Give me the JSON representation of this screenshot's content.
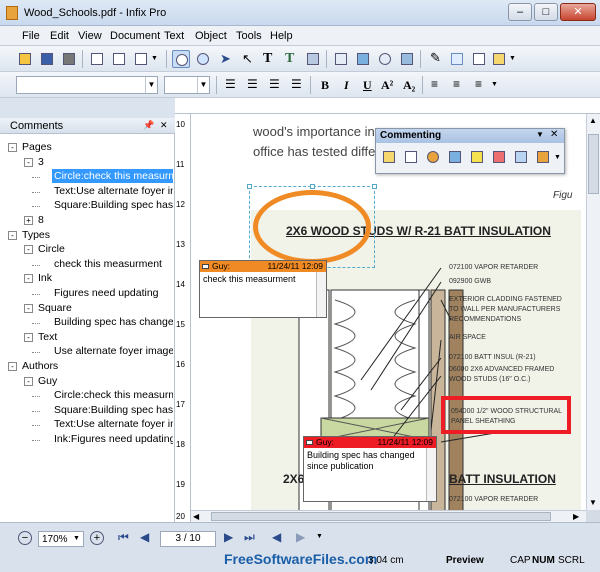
{
  "window": {
    "title": "Wood_Schools.pdf - Infix Pro",
    "min": "–",
    "max": "□",
    "close": "✕"
  },
  "menu": [
    "File",
    "Edit",
    "View",
    "Document",
    "Text",
    "Object",
    "Tools",
    "Help"
  ],
  "comments_panel": {
    "title": "Comments",
    "pin": "📌",
    "close": "✕",
    "tree": [
      {
        "label": "Pages",
        "level": 0,
        "exp": "-"
      },
      {
        "label": "3",
        "level": 1,
        "exp": "-"
      },
      {
        "label": "Circle:check this measurment",
        "level": 2,
        "selected": true
      },
      {
        "label": "Text:Use alternate foyer image",
        "level": 2
      },
      {
        "label": "Square:Building spec has changed",
        "level": 2
      },
      {
        "label": "8",
        "level": 1,
        "exp": "+"
      },
      {
        "label": "Types",
        "level": 0,
        "exp": "-"
      },
      {
        "label": "Circle",
        "level": 1,
        "exp": "-"
      },
      {
        "label": "check this measurment",
        "level": 2
      },
      {
        "label": "Ink",
        "level": 1,
        "exp": "-"
      },
      {
        "label": "Figures need updating",
        "level": 2
      },
      {
        "label": "Square",
        "level": 1,
        "exp": "-"
      },
      {
        "label": "Building spec has changed",
        "level": 2
      },
      {
        "label": "Text",
        "level": 1,
        "exp": "-"
      },
      {
        "label": "Use alternate foyer image",
        "level": 2
      },
      {
        "label": "Authors",
        "level": 0,
        "exp": "-"
      },
      {
        "label": "Guy",
        "level": 1,
        "exp": "-"
      },
      {
        "label": "Circle:check this measurment",
        "level": 2
      },
      {
        "label": "Square:Building spec has changed",
        "level": 2
      },
      {
        "label": "Text:Use alternate foyer image",
        "level": 2
      },
      {
        "label": "Ink:Figures need updating",
        "level": 2
      }
    ]
  },
  "ruler_left": [
    "10",
    "11",
    "12",
    "13",
    "14",
    "15",
    "16",
    "17",
    "18",
    "19",
    "20"
  ],
  "document": {
    "line1": "wood's importance in",
    "line2": "office has tested diffe",
    "fig": "Figu",
    "heading": "2X6 WOOD STUDS W/ R-21 BATT INSULATION",
    "heading2a": "2X6",
    "heading2b": "BATT INSULATION",
    "labels": [
      "072100 VAPOR RETARDER",
      "092900 GWB",
      "EXTERIOR CLADDING FASTENED",
      "TO WALL PER MANUFACTURERS",
      "RECOMMENDATIONS",
      "AIR SPACE",
      "072100 BATT INSUL (R-21)",
      "06000 2X6 ADVANCED FRAMED",
      "WOOD STUDS (16\" O.C.)"
    ],
    "boxed_label_1": "054000 1/2\" WOOD STRUCTURAL",
    "boxed_label_2": "PANEL SHEATHING",
    "bottom_label": "072100 VAPOR RETARDER"
  },
  "commenting": {
    "title": "Commenting"
  },
  "notes": [
    {
      "author": "Guy:",
      "date": "11/24/11 12:09",
      "text": "check this measurment",
      "color": "#f08a24"
    },
    {
      "author": "Guy:",
      "date": "11/24/11 12:09",
      "text": "Building spec has changed since publication",
      "color": "#ee1c24"
    }
  ],
  "status": {
    "zoom": "170%",
    "page": "3 / 10",
    "coords": "3.04 cm",
    "mode": "Preview",
    "cap": "CAP",
    "num": "NUM",
    "scrl": "SCRL",
    "watermark": "FreeSoftwareFiles.com"
  }
}
